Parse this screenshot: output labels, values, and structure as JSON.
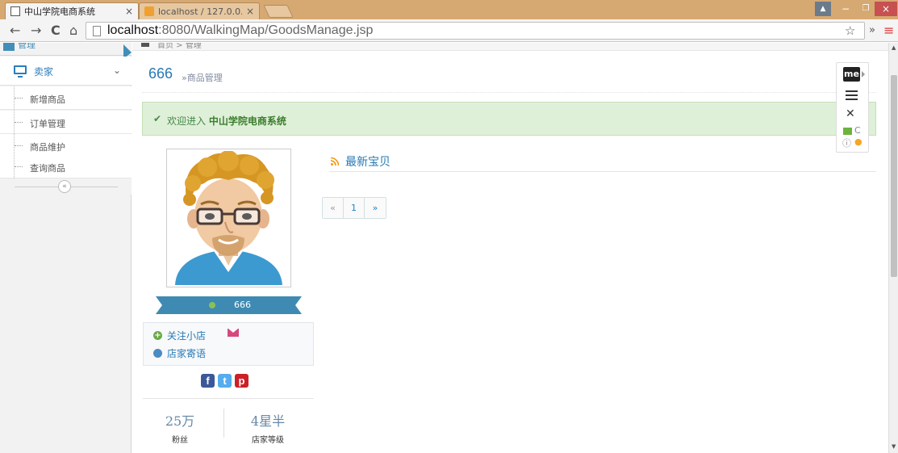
{
  "browser": {
    "tabs": [
      {
        "title": "中山学院电商系统",
        "active": true
      },
      {
        "title": "localhost / 127.0.0.1 / s",
        "active": false
      }
    ],
    "close_glyph": "×",
    "url_host": "localhost",
    "url_rest": ":8080/WalkingMap/GoodsManage.jsp",
    "window_buttons": {
      "user": "▲",
      "minimize": "−",
      "restore": "❐",
      "close": "×"
    },
    "toolbar_glyphs": {
      "back": "←",
      "forward": "→",
      "reload": "C",
      "home": "⌂",
      "star": "☆",
      "more": "»",
      "menu": "≡"
    }
  },
  "sidebar": {
    "top_label": "管理",
    "section_label": "卖家",
    "section_chevron": "⌄",
    "items": [
      {
        "label": "新增商品"
      },
      {
        "label": "订单管理"
      },
      {
        "label": "商品维护"
      },
      {
        "label": "查询商品"
      }
    ],
    "collapse_glyph": "«"
  },
  "breadcrumb": {
    "text": "首页 > 管理"
  },
  "page_header": {
    "title": "666",
    "subtitle": "»商品管理"
  },
  "alert": {
    "check_glyph": "✔",
    "prefix": "欢迎进入",
    "emphasis": "中山学院电商系统"
  },
  "profile": {
    "name": "666",
    "status_color": "#8cc152",
    "links": [
      {
        "label": "关注小店",
        "icon": "plus-circle-icon"
      },
      {
        "label": "店家寄语",
        "icon": "globe-icon"
      }
    ],
    "plus_glyph": "+",
    "social": [
      {
        "name": "facebook-icon",
        "glyph": "f",
        "color": "#3b5998"
      },
      {
        "name": "twitter-icon",
        "glyph": "t",
        "color": "#55acee"
      },
      {
        "name": "pinterest-icon",
        "glyph": "p",
        "color": "#cb2027"
      }
    ],
    "stats": [
      {
        "value": "25万",
        "caption": "粉丝"
      },
      {
        "value": "4星半",
        "caption": "店家等级"
      }
    ]
  },
  "newest": {
    "label": "最新宝贝",
    "rss_color": "#f89406"
  },
  "pagination": {
    "prev": "«",
    "current": "1",
    "next": "»"
  },
  "extension": {
    "me_label": "me",
    "wand_glyph": "✕",
    "reload_glyph": "C",
    "info_glyph": "ⓘ",
    "eye_glyph": "●"
  },
  "colors": {
    "accent": "#2679b5",
    "success_bg": "#dff0d8",
    "ribbon": "#3e8ab3"
  }
}
